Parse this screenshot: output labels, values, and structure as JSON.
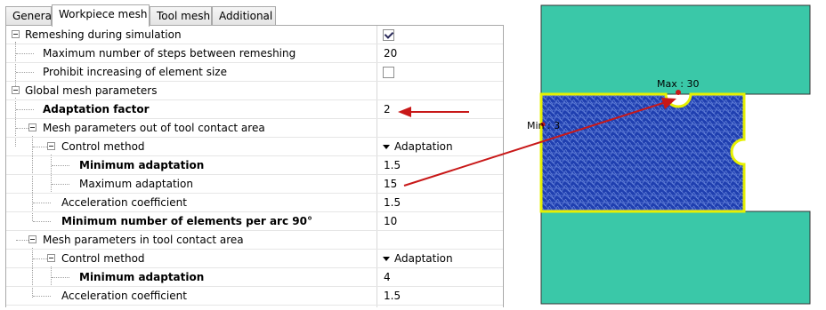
{
  "tabs": [
    "General",
    "Workpiece mesh",
    "Tool mesh",
    "Additional"
  ],
  "active_tab": "Workpiece mesh",
  "rows": [
    {
      "label": "Remeshing during simulation",
      "value": "",
      "control": "checkbox",
      "checked": true
    },
    {
      "label": "Maximum number of steps between remeshing",
      "value": "20"
    },
    {
      "label": "Prohibit increasing of element size",
      "value": "",
      "control": "checkbox",
      "checked": false
    },
    {
      "label": "Global mesh parameters",
      "value": ""
    },
    {
      "label": "Adaptation factor",
      "value": "2"
    },
    {
      "label": "Mesh parameters out of tool contact area",
      "value": ""
    },
    {
      "label": "Control method",
      "value": "Adaptation",
      "control": "dropdown"
    },
    {
      "label": "Minimum adaptation",
      "value": "1.5"
    },
    {
      "label": "Maximum adaptation",
      "value": "15"
    },
    {
      "label": "Acceleration coefficient",
      "value": "1.5"
    },
    {
      "label": "Minimum number of elements per arc 90°",
      "value": "10"
    },
    {
      "label": "Mesh parameters in tool contact area",
      "value": ""
    },
    {
      "label": "Control method",
      "value": "Adaptation",
      "control": "dropdown"
    },
    {
      "label": "Minimum adaptation",
      "value": "4"
    },
    {
      "label": "Acceleration coefficient",
      "value": "1.5"
    }
  ],
  "viewport": {
    "max_label": "Max : 30",
    "min_label": "Min : 3"
  },
  "colors": {
    "tool": "#3ac8a8",
    "mesh": "#1f3fb0",
    "mesh_line": "#6f8de0",
    "edge": "#e6f000",
    "arrow": "#c81818",
    "selection": "#cde8ff"
  }
}
